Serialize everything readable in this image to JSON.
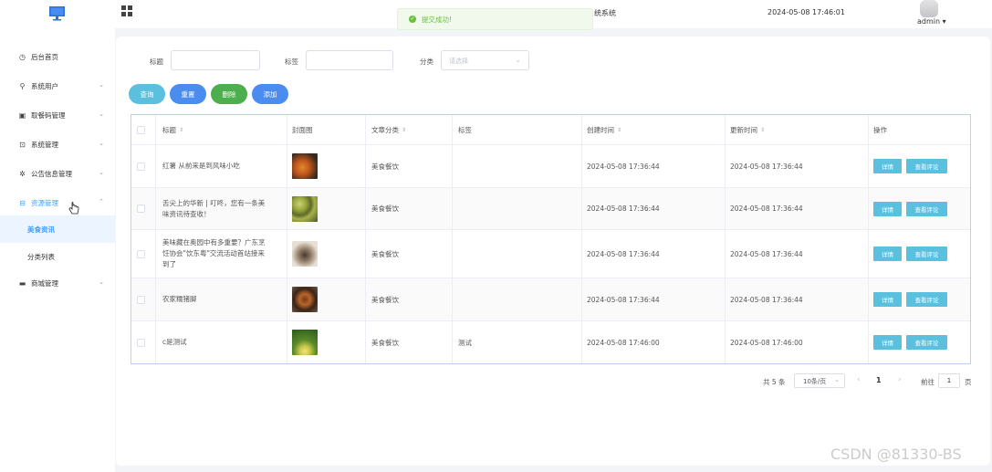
{
  "header": {
    "system_title": "统系统",
    "datetime": "2024-05-08 17:46:01",
    "username": "admin ▾"
  },
  "toast": {
    "message": "提交成功!"
  },
  "sidebar": {
    "items": [
      {
        "label": "后台首页",
        "icon": "clock-icon"
      },
      {
        "label": "系统用户",
        "icon": "user-icon"
      },
      {
        "label": "取餐码管理",
        "icon": "card-icon"
      },
      {
        "label": "系统管理",
        "icon": "image-icon"
      },
      {
        "label": "公告信息管理",
        "icon": "puzzle-icon"
      },
      {
        "label": "资源管理",
        "icon": "grid-icon"
      },
      {
        "label": "商城管理",
        "icon": "wallet-icon"
      }
    ],
    "subitems": [
      {
        "label": "美食资讯"
      },
      {
        "label": "分类列表"
      }
    ]
  },
  "filters": {
    "title_label": "标题",
    "tag_label": "标签",
    "category_label": "分类",
    "category_placeholder": "请选择"
  },
  "actions": {
    "query": "查询",
    "reset": "重置",
    "delete": "删除",
    "add": "添加"
  },
  "table": {
    "headers": {
      "title": "标题",
      "cover": "封面图",
      "category": "文章分类",
      "tags": "标签",
      "created": "创建时间",
      "updated": "更新时间",
      "ops": "操作"
    },
    "rows": [
      {
        "title": "红薯 从前来是到风味小吃",
        "category": "美食餐饮",
        "tags": "",
        "created": "2024-05-08 17:36:44",
        "updated": "2024-05-08 17:36:44",
        "detail": "详情",
        "review": "查看评论"
      },
      {
        "title": "舌尖上的华新 | 叮咚，您有一条美味资讯待查收！",
        "category": "美食餐饮",
        "tags": "",
        "created": "2024-05-08 17:36:44",
        "updated": "2024-05-08 17:36:44",
        "detail": "详情",
        "review": "查看评论"
      },
      {
        "title": "美味藏在奥园中有多重要？广东烹饪协会\"饮东粤\"交流活动首站接来到了",
        "category": "美食餐饮",
        "tags": "",
        "created": "2024-05-08 17:36:44",
        "updated": "2024-05-08 17:36:44",
        "detail": "详情",
        "review": "查看评论"
      },
      {
        "title": "农家糯猪脚",
        "category": "美食餐饮",
        "tags": "",
        "created": "2024-05-08 17:36:44",
        "updated": "2024-05-08 17:36:44",
        "detail": "详情",
        "review": "查看评论"
      },
      {
        "title": "c是测试",
        "category": "美食餐饮",
        "tags": "测试",
        "created": "2024-05-08 17:46:00",
        "updated": "2024-05-08 17:46:00",
        "detail": "详情",
        "review": "查看评论"
      }
    ]
  },
  "pagination": {
    "total": "共 5 条",
    "page_size": "10条/页",
    "current": "1",
    "goto_label": "前往",
    "goto_value": "1",
    "page_unit": "页"
  },
  "watermark": "CSDN @81330-BS",
  "colors": {
    "primary": "#409eff",
    "info": "#5bc0de",
    "success": "#4cae4c",
    "toast_bg": "#f0f9eb",
    "toast_text": "#67c23a"
  }
}
